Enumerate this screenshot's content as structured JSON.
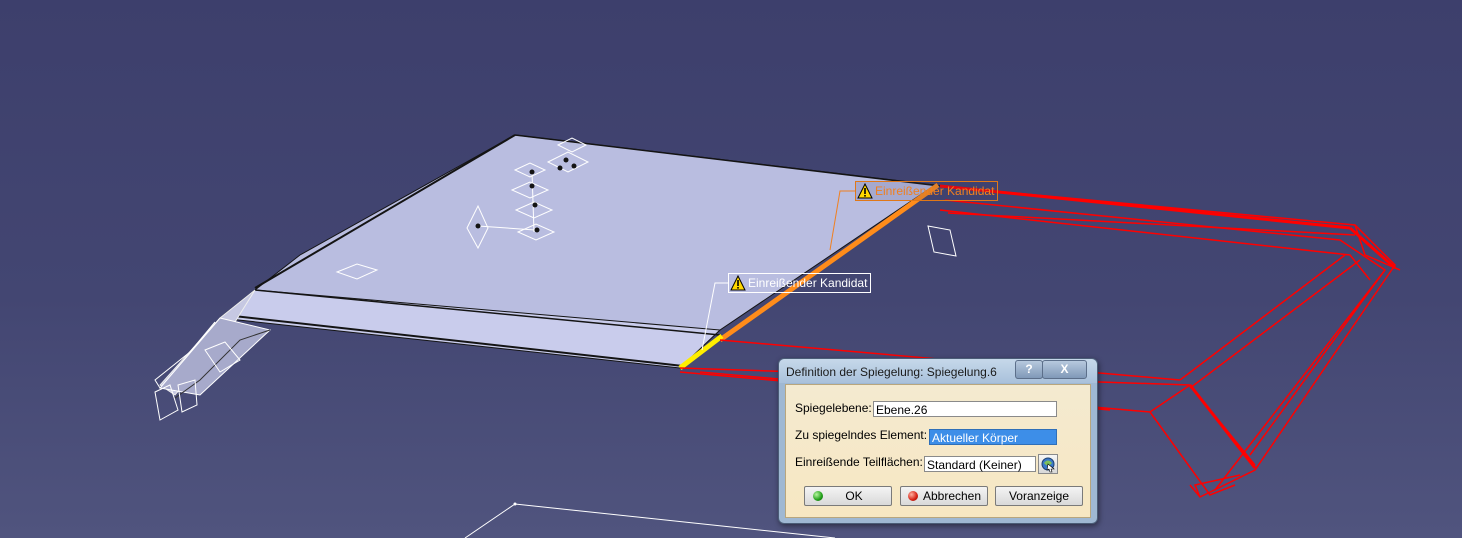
{
  "viewport": {
    "background_top": "#3d3f6c",
    "background_bottom": "#50547e",
    "part_face_color": "#b9bde0",
    "edge_color": "#141414",
    "mirrored_wireframe_color": "#ff0000",
    "highlight_edge_color": "#ff8c1a",
    "highlight_point_color": "#ffee00"
  },
  "callouts": {
    "top": {
      "text": "Einreißender Kandidat",
      "color": "#f08020",
      "icon": "warning-icon"
    },
    "bottom": {
      "text": "Einreißender Kandidat",
      "color": "#ffffff",
      "icon": "warning-icon"
    }
  },
  "dialog": {
    "title": "Definition der Spiegelung: Spiegelung.6",
    "help_label": "?",
    "close_label": "X",
    "fields": {
      "mirror_plane": {
        "label": "Spiegelebene:",
        "value": "Ebene.26"
      },
      "element": {
        "label": "Zu spiegelndes Element:",
        "value": "Aktueller Körper"
      },
      "faces": {
        "label": "Einreißende Teilflächen:",
        "value": "Standard (Keiner)",
        "picker_icon": "selection-picker-icon"
      }
    },
    "buttons": {
      "ok": "OK",
      "cancel": "Abbrechen",
      "preview": "Voranzeige"
    }
  }
}
